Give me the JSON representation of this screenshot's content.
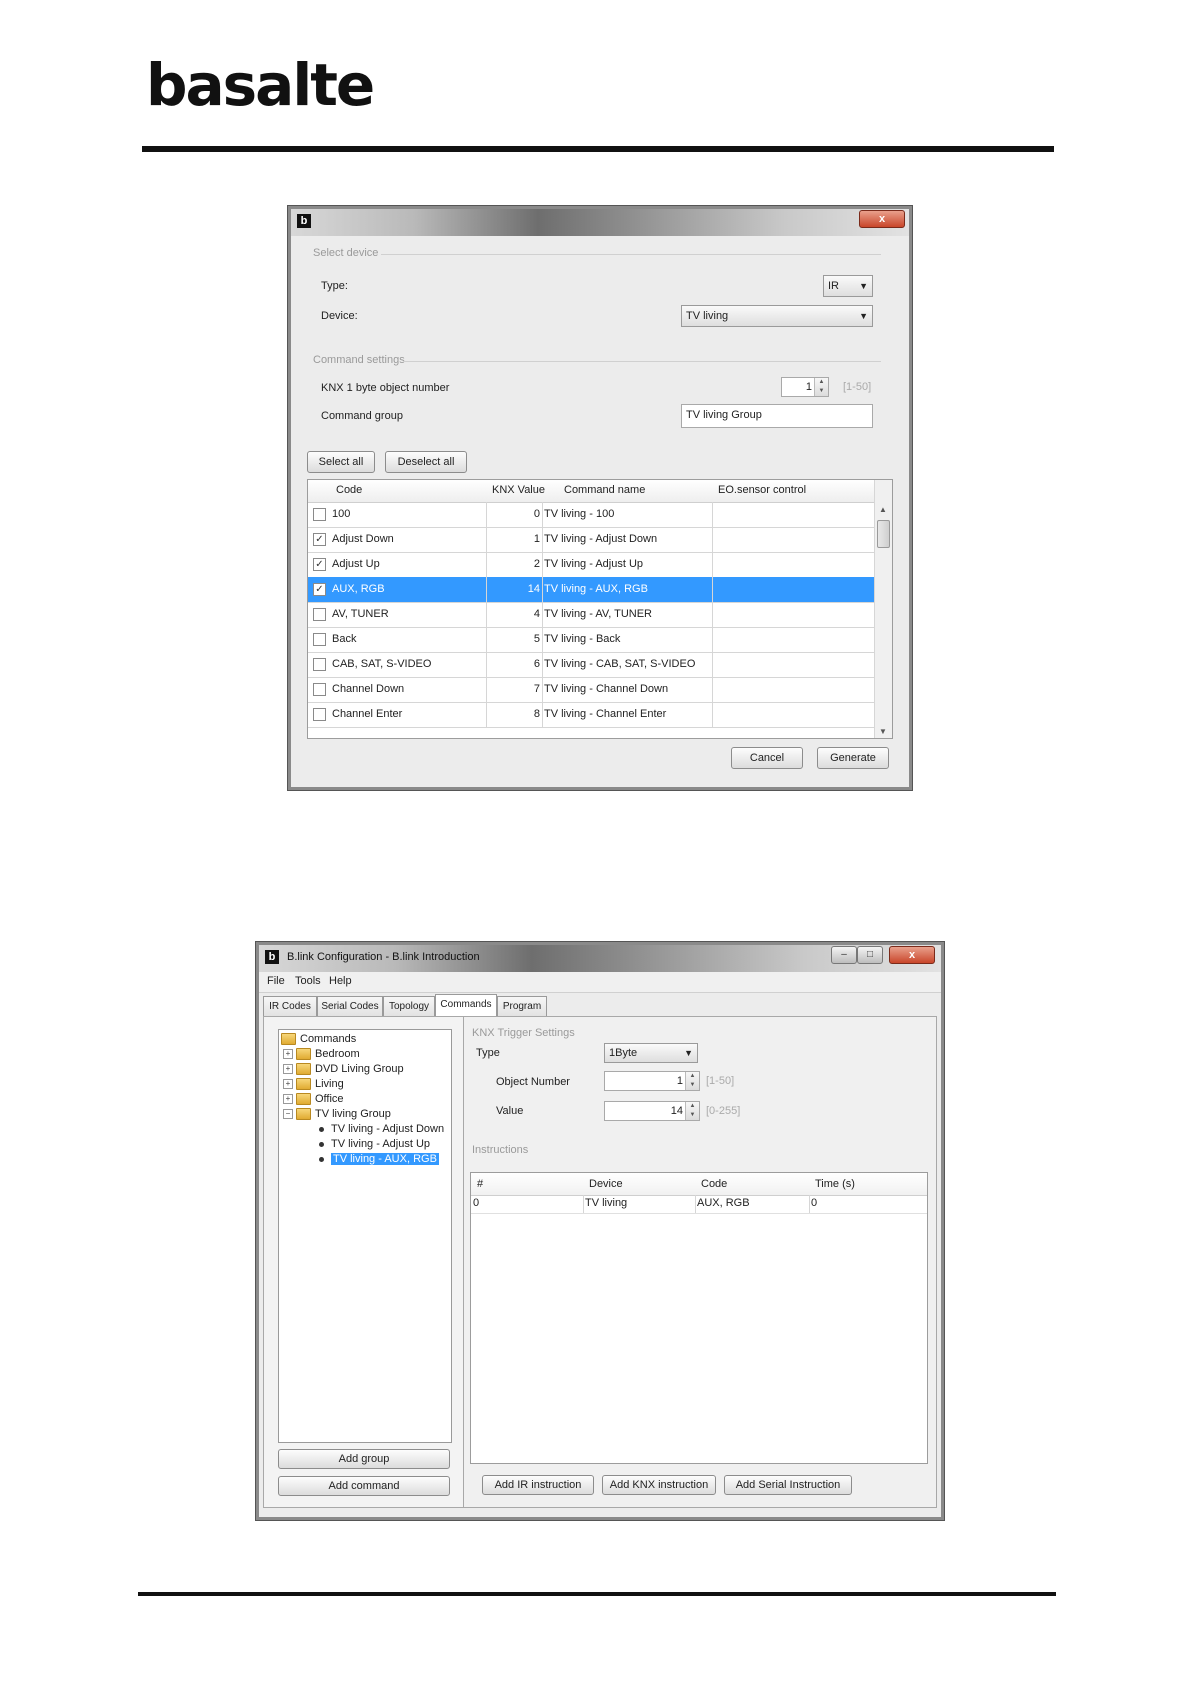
{
  "brand": {
    "logo": "basalte"
  },
  "dialog": {
    "icon": "b",
    "close": "x",
    "select_device": "Select device",
    "type_label": "Type:",
    "type_value": "IR",
    "device_label": "Device:",
    "device_value": "TV living",
    "command_settings": "Command settings",
    "knx_label": "KNX 1 byte object number",
    "knx_value": "1",
    "knx_range": "[1-50]",
    "group_label": "Command group",
    "group_value": "TV living Group",
    "select_all": "Select all",
    "deselect_all": "Deselect all",
    "columns": [
      "Code",
      "KNX Value",
      "Command name",
      "EO.sensor control"
    ],
    "rows": [
      {
        "code": "100",
        "value": "0",
        "name": "TV living - 100",
        "checked": false
      },
      {
        "code": "Adjust Down",
        "value": "1",
        "name": "TV living - Adjust Down",
        "checked": true
      },
      {
        "code": "Adjust Up",
        "value": "2",
        "name": "TV living - Adjust Up",
        "checked": true
      },
      {
        "code": "AUX, RGB",
        "value": "14",
        "name": "TV living - AUX, RGB",
        "checked": true,
        "selected": true
      },
      {
        "code": "AV,  TUNER",
        "value": "4",
        "name": "TV living - AV,  TUNER",
        "checked": false
      },
      {
        "code": "Back",
        "value": "5",
        "name": "TV living - Back",
        "checked": false
      },
      {
        "code": "CAB, SAT, S-VIDEO",
        "value": "6",
        "name": "TV living - CAB, SAT, S-VIDEO",
        "checked": false
      },
      {
        "code": "Channel Down",
        "value": "7",
        "name": "TV living - Channel Down",
        "checked": false
      },
      {
        "code": "Channel Enter",
        "value": "8",
        "name": "TV living - Channel Enter",
        "checked": false
      }
    ],
    "cancel": "Cancel",
    "generate": "Generate"
  },
  "app": {
    "icon": "b",
    "title": "B.link Configuration - B.link Introduction",
    "menu": [
      "File",
      "Tools",
      "Help"
    ],
    "tabs": [
      "IR Codes",
      "Serial Codes",
      "Topology",
      "Commands",
      "Program"
    ],
    "active_tab": "Commands",
    "tree": {
      "root": "Commands",
      "groups": [
        "Bedroom",
        "DVD Living Group",
        "Living",
        "Office",
        "TV living Group"
      ],
      "children": [
        "TV living - Adjust Down",
        "TV living - Adjust Up",
        "TV living - AUX, RGB"
      ]
    },
    "add_group": "Add group",
    "add_command": "Add command",
    "knx_trigger": "KNX Trigger Settings",
    "type_label": "Type",
    "type_value": "1Byte",
    "object_label": "Object Number",
    "object_value": "1",
    "object_range": "[1-50]",
    "value_label": "Value",
    "value_value": "14",
    "value_range": "[0-255]",
    "instructions": "Instructions",
    "instr_columns": [
      "#",
      "Device",
      "Code",
      "Time (s)"
    ],
    "instr_row": [
      "0",
      "TV living",
      "AUX, RGB",
      "0"
    ],
    "add_ir": "Add IR instruction",
    "add_knx": "Add KNX instruction",
    "add_serial": "Add Serial Instruction"
  }
}
